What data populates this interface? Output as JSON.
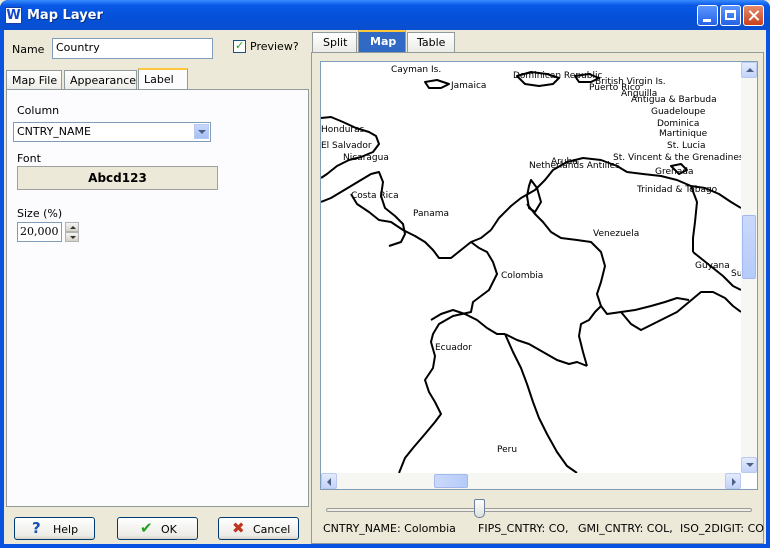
{
  "window": {
    "title": "Map Layer",
    "app_icon_letter": "W"
  },
  "left": {
    "name_label": "Name",
    "name_value": "Country",
    "preview_label": "Preview?",
    "preview_checked": true,
    "tabs": [
      {
        "label": "Map File",
        "active": false
      },
      {
        "label": "Appearance",
        "active": false
      },
      {
        "label": "Label",
        "active": true
      }
    ],
    "column_label": "Column",
    "column_value": "CNTRY_NAME",
    "font_label": "Font",
    "font_sample": "Abcd123",
    "size_label": "Size (%)",
    "size_value": "20,000"
  },
  "buttons": {
    "help": "Help",
    "ok": "OK",
    "cancel": "Cancel"
  },
  "right": {
    "tabs": [
      {
        "label": "Split",
        "active": false
      },
      {
        "label": "Map",
        "active": true
      },
      {
        "label": "Table",
        "active": false
      }
    ],
    "map_labels": [
      "Cayman Is.",
      "Jamaica",
      "Dominican Republic",
      "British Virgin Is.",
      "Puerto Rico",
      "Anguilla",
      "Antigua & Barbuda",
      "Guadeloupe",
      "Dominica",
      "Martinique",
      "St. Lucia",
      "St. Vincent & the Grenadines",
      "Grenada",
      "Trinidad & Tobago",
      "Netherlands Antilles",
      "Aruba",
      "Honduras",
      "El Salvador",
      "Nicaragua",
      "Costa Rica",
      "Panama",
      "Venezuela",
      "Colombia",
      "Guyana",
      "Ecuador",
      "Peru",
      "Suriname"
    ],
    "slider_fraction": 0.36,
    "status": [
      "CNTRY_NAME: Colombia",
      "FIPS_CNTRY: CO,",
      "GMI_CNTRY: COL,",
      "ISO_2DIGIT: CO"
    ]
  },
  "colors": {
    "title_bar": "#0858e6",
    "dialog_bg": "#ece9d8",
    "active_tab_accent": "#ffc83c",
    "ok_check": "#21a121",
    "cancel_x": "#c0341d"
  }
}
